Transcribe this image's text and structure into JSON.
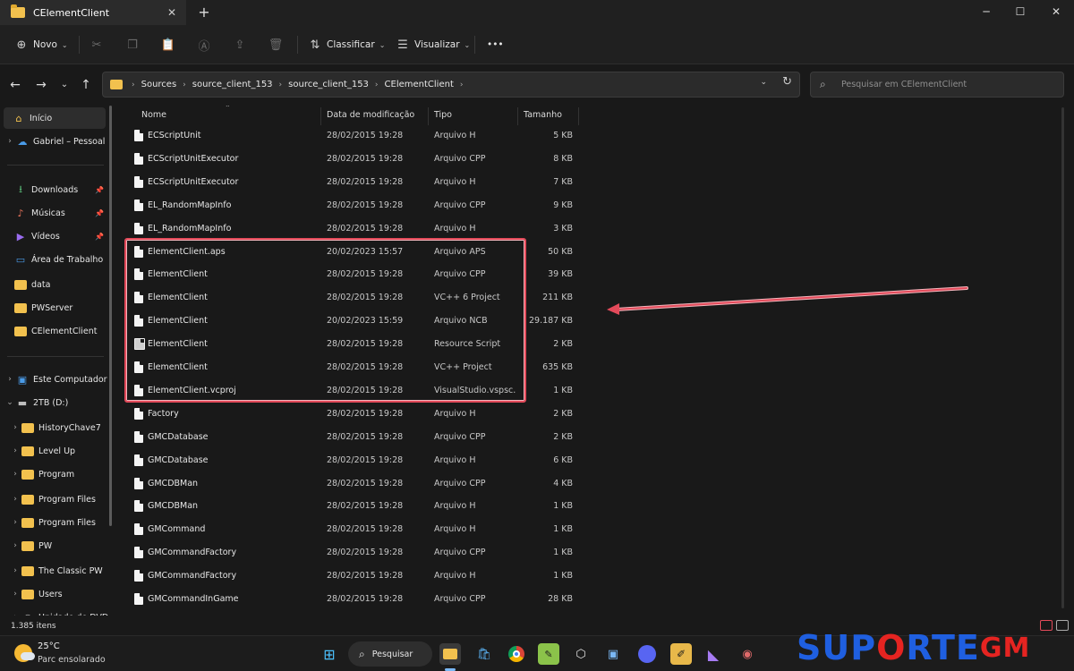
{
  "window": {
    "tab_title": "CElementClient",
    "tab_close": "✕",
    "new_tab": "+",
    "minimize": "─",
    "maximize": "☐",
    "close": "✕"
  },
  "toolbar": {
    "new_label": "Novo",
    "sort_label": "Classificar",
    "view_label": "Visualizar",
    "more": "•••"
  },
  "address": {
    "crumbs": [
      "Sources",
      "source_client_153",
      "source_client_153",
      "CElementClient"
    ],
    "separator": "›"
  },
  "search": {
    "placeholder": "Pesquisar em CElementClient"
  },
  "sidebar": {
    "items": [
      {
        "label": "Início",
        "icon": "home-icon"
      },
      {
        "label": "Gabriel – Pessoal",
        "icon": "onedrive-icon"
      },
      {
        "label": "Downloads",
        "icon": "download-icon",
        "pinned": true
      },
      {
        "label": "Músicas",
        "icon": "music-icon",
        "pinned": true
      },
      {
        "label": "Vídeos",
        "icon": "video-icon",
        "pinned": true
      },
      {
        "label": "Área de Trabalho",
        "icon": "desktop-icon"
      },
      {
        "label": "data",
        "icon": "folder-icon"
      },
      {
        "label": "PWServer",
        "icon": "folder-icon"
      },
      {
        "label": "CElementClient",
        "icon": "folder-icon"
      },
      {
        "label": "Este Computador",
        "icon": "computer-icon"
      },
      {
        "label": "2TB (D:)",
        "icon": "drive-icon"
      },
      {
        "label": "HistoryChave7",
        "icon": "folder-icon"
      },
      {
        "label": "Level Up",
        "icon": "folder-icon"
      },
      {
        "label": "Program",
        "icon": "folder-icon"
      },
      {
        "label": "Program Files",
        "icon": "folder-icon"
      },
      {
        "label": "Program Files",
        "icon": "folder-icon"
      },
      {
        "label": "PW",
        "icon": "folder-icon"
      },
      {
        "label": "The Classic PW",
        "icon": "folder-icon"
      },
      {
        "label": "Users",
        "icon": "folder-icon"
      },
      {
        "label": "Unidade de DVD",
        "icon": "dvd-icon"
      }
    ]
  },
  "columns": {
    "name": "Nome",
    "modified": "Data de modificação",
    "type": "Tipo",
    "size": "Tamanho"
  },
  "files": [
    {
      "name": "ECScriptUnit",
      "modified": "28/02/2015 19:28",
      "type": "Arquivo H",
      "size": "5 KB"
    },
    {
      "name": "ECScriptUnitExecutor",
      "modified": "28/02/2015 19:28",
      "type": "Arquivo CPP",
      "size": "8 KB"
    },
    {
      "name": "ECScriptUnitExecutor",
      "modified": "28/02/2015 19:28",
      "type": "Arquivo H",
      "size": "7 KB"
    },
    {
      "name": "EL_RandomMapInfo",
      "modified": "28/02/2015 19:28",
      "type": "Arquivo CPP",
      "size": "9 KB"
    },
    {
      "name": "EL_RandomMapInfo",
      "modified": "28/02/2015 19:28",
      "type": "Arquivo H",
      "size": "3 KB"
    },
    {
      "name": "ElementClient.aps",
      "modified": "20/02/2023 15:57",
      "type": "Arquivo APS",
      "size": "50 KB"
    },
    {
      "name": "ElementClient",
      "modified": "28/02/2015 19:28",
      "type": "Arquivo CPP",
      "size": "39 KB"
    },
    {
      "name": "ElementClient",
      "modified": "28/02/2015 19:28",
      "type": "VC++ 6 Project",
      "size": "211 KB"
    },
    {
      "name": "ElementClient",
      "modified": "20/02/2023 15:59",
      "type": "Arquivo NCB",
      "size": "29.187 KB"
    },
    {
      "name": "ElementClient",
      "modified": "28/02/2015 19:28",
      "type": "Resource Script",
      "size": "2 KB",
      "resource": true
    },
    {
      "name": "ElementClient",
      "modified": "28/02/2015 19:28",
      "type": "VC++ Project",
      "size": "635 KB"
    },
    {
      "name": "ElementClient.vcproj",
      "modified": "28/02/2015 19:28",
      "type": "VisualStudio.vspsc...",
      "size": "1 KB"
    },
    {
      "name": "Factory",
      "modified": "28/02/2015 19:28",
      "type": "Arquivo H",
      "size": "2 KB"
    },
    {
      "name": "GMCDatabase",
      "modified": "28/02/2015 19:28",
      "type": "Arquivo CPP",
      "size": "2 KB"
    },
    {
      "name": "GMCDatabase",
      "modified": "28/02/2015 19:28",
      "type": "Arquivo H",
      "size": "6 KB"
    },
    {
      "name": "GMCDBMan",
      "modified": "28/02/2015 19:28",
      "type": "Arquivo CPP",
      "size": "4 KB"
    },
    {
      "name": "GMCDBMan",
      "modified": "28/02/2015 19:28",
      "type": "Arquivo H",
      "size": "1 KB"
    },
    {
      "name": "GMCommand",
      "modified": "28/02/2015 19:28",
      "type": "Arquivo H",
      "size": "1 KB"
    },
    {
      "name": "GMCommandFactory",
      "modified": "28/02/2015 19:28",
      "type": "Arquivo CPP",
      "size": "1 KB"
    },
    {
      "name": "GMCommandFactory",
      "modified": "28/02/2015 19:28",
      "type": "Arquivo H",
      "size": "1 KB"
    },
    {
      "name": "GMCommandInGame",
      "modified": "28/02/2015 19:28",
      "type": "Arquivo CPP",
      "size": "28 KB"
    }
  ],
  "status": {
    "item_count": "1.385 itens"
  },
  "taskbar": {
    "temperature": "25°C",
    "weather": "Parc ensolarado",
    "search_label": "Pesquisar"
  },
  "watermark": {
    "text_a": "SUP",
    "text_o": "O",
    "text_b": "RTE",
    "text_c": "GM"
  },
  "colors": {
    "accent_highlight": "#e34a5a",
    "folder": "#f2c14e",
    "watermark_blue": "#1f5fe0",
    "watermark_red": "#e52421"
  }
}
